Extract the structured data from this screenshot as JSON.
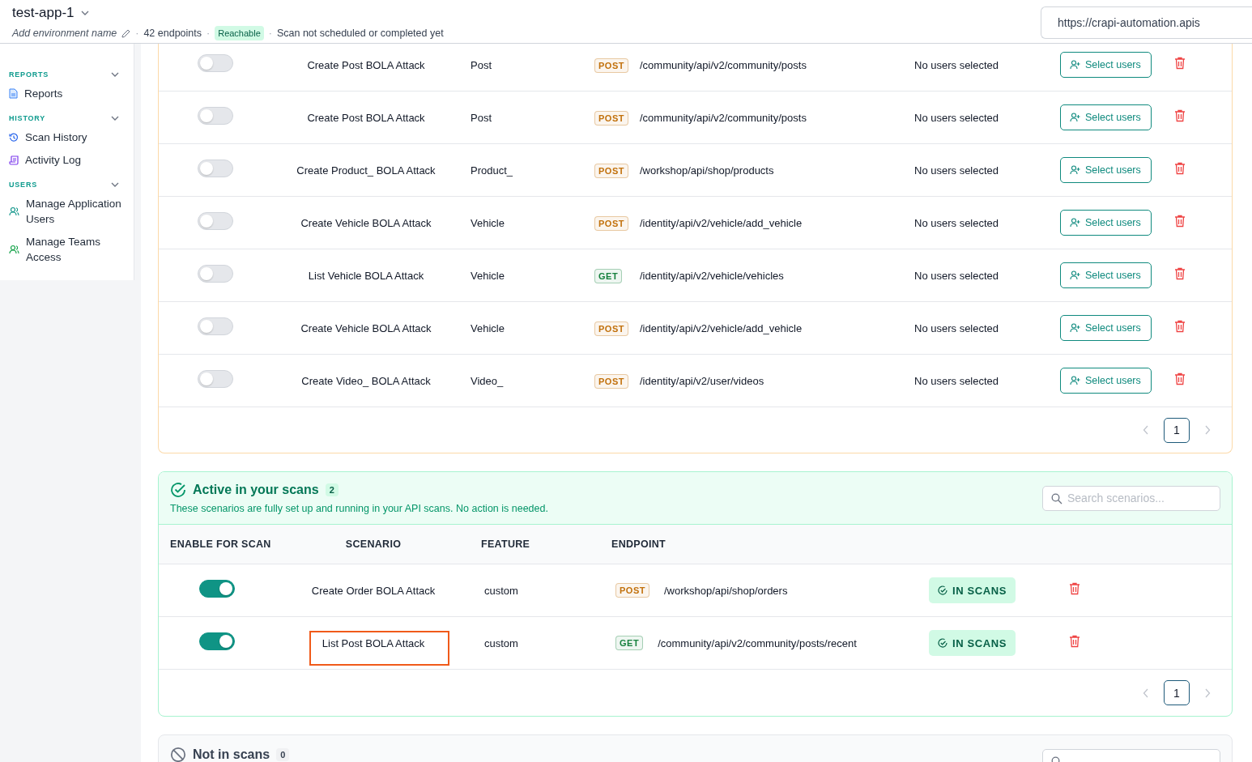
{
  "header": {
    "title": "test-app-1",
    "environment_placeholder": "Add environment name",
    "endpoints": "42 endpoints",
    "status": "Reachable",
    "separators": [
      "·",
      "·",
      "·"
    ],
    "scan_status": "Scan not scheduled or completed yet",
    "url": "https://crapi-automation.apis"
  },
  "sidebar": {
    "sections": [
      {
        "title": "REPORTS",
        "expanded": true,
        "items": [
          {
            "label": "Reports",
            "kind": "report"
          }
        ]
      },
      {
        "title": "HISTORY",
        "expanded": true,
        "items": [
          {
            "label": "Scan History",
            "kind": "history"
          },
          {
            "label": "Activity Log",
            "kind": "log"
          }
        ]
      },
      {
        "title": "USERS",
        "expanded": true,
        "items": [
          {
            "label": "Manage Application Users",
            "kind": "users"
          },
          {
            "label": "Manage Teams Access",
            "kind": "team"
          }
        ]
      }
    ]
  },
  "pending_card": {
    "rows": [
      {
        "enabled": false,
        "scenario": "Create Post BOLA Attack",
        "feature": "Post",
        "method": {
          "label": "POST",
          "kind": "post"
        },
        "endpoint": "/community/api/v2/community/posts",
        "users": "No users selected",
        "action": "Select users"
      },
      {
        "enabled": false,
        "scenario": "Create Post BOLA Attack",
        "feature": "Post",
        "method": {
          "label": "POST",
          "kind": "post"
        },
        "endpoint": "/community/api/v2/community/posts",
        "users": "No users selected",
        "action": "Select users"
      },
      {
        "enabled": false,
        "scenario": "Create Product_ BOLA Attack",
        "feature": "Product_",
        "method": {
          "label": "POST",
          "kind": "post"
        },
        "endpoint": "/workshop/api/shop/products",
        "users": "No users selected",
        "action": "Select users"
      },
      {
        "enabled": false,
        "scenario": "Create Vehicle BOLA Attack",
        "feature": "Vehicle",
        "method": {
          "label": "POST",
          "kind": "post"
        },
        "endpoint": "/identity/api/v2/vehicle/add_vehicle",
        "users": "No users selected",
        "action": "Select users"
      },
      {
        "enabled": false,
        "scenario": "List Vehicle BOLA Attack",
        "feature": "Vehicle",
        "method": {
          "label": "GET",
          "kind": "get"
        },
        "endpoint": "/identity/api/v2/vehicle/vehicles",
        "users": "No users selected",
        "action": "Select users"
      },
      {
        "enabled": false,
        "scenario": "Create Vehicle BOLA Attack",
        "feature": "Vehicle",
        "method": {
          "label": "POST",
          "kind": "post"
        },
        "endpoint": "/identity/api/v2/vehicle/add_vehicle",
        "users": "No users selected",
        "action": "Select users"
      },
      {
        "enabled": false,
        "scenario": "Create Video_ BOLA Attack",
        "feature": "Video_",
        "method": {
          "label": "POST",
          "kind": "post"
        },
        "endpoint": "/identity/api/v2/user/videos",
        "users": "No users selected",
        "action": "Select users"
      }
    ],
    "page": "1"
  },
  "active_card": {
    "title": "Active in your scans",
    "count": "2",
    "description": "These scenarios are fully set up and running in your API scans. No action is needed.",
    "search_placeholder": "Search scenarios...",
    "columns": [
      "ENABLE FOR SCAN",
      "SCENARIO",
      "FEATURE",
      "ENDPOINT"
    ],
    "rows": [
      {
        "enabled": true,
        "scenario": "Create Order BOLA Attack",
        "feature": "custom",
        "method": {
          "label": "POST",
          "kind": "post"
        },
        "endpoint": "/workshop/api/shop/orders",
        "status": "IN SCANS",
        "highlighted": false
      },
      {
        "enabled": true,
        "scenario": "List Post BOLA Attack",
        "feature": "custom",
        "method": {
          "label": "GET",
          "kind": "get"
        },
        "endpoint": "/community/api/v2/community/posts/recent",
        "status": "IN SCANS",
        "highlighted": true
      }
    ],
    "page": "1"
  },
  "inactive_card": {
    "title": "Not in scans",
    "count": "0"
  }
}
